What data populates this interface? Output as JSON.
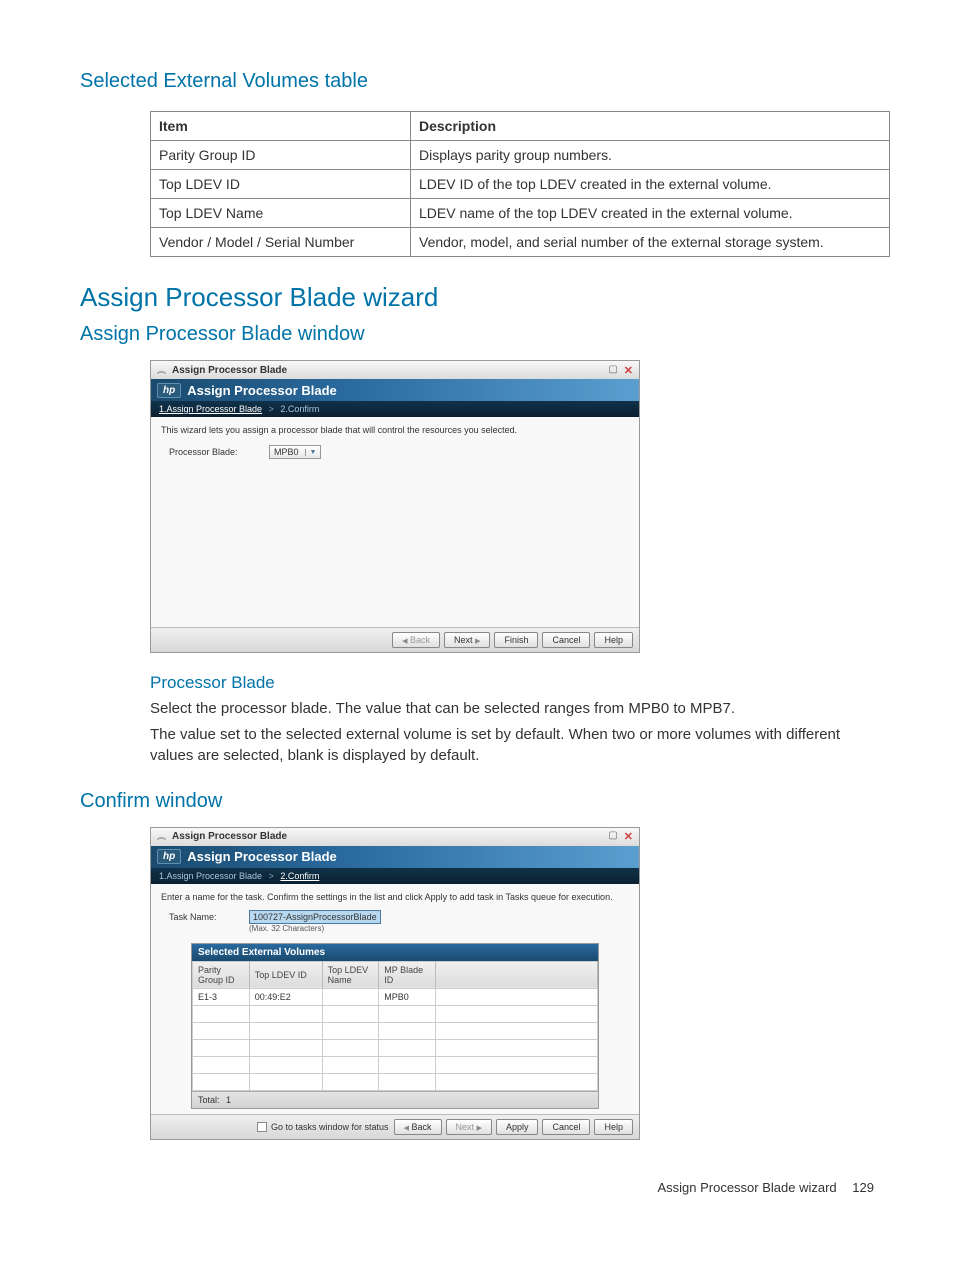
{
  "section1_title": "Selected External Volumes table",
  "table1": {
    "headers": [
      "Item",
      "Description"
    ],
    "rows": [
      [
        "Parity Group ID",
        "Displays parity group numbers."
      ],
      [
        "Top LDEV ID",
        "LDEV ID of the top LDEV created in the external volume."
      ],
      [
        "Top LDEV Name",
        "LDEV name of the top LDEV created in the external volume."
      ],
      [
        "Vendor / Model / Serial Number",
        "Vendor, model, and serial number of the external storage system."
      ]
    ]
  },
  "main_heading": "Assign Processor Blade wizard",
  "sub_heading1": "Assign Processor Blade window",
  "wizard1": {
    "titlebar": "Assign Processor Blade",
    "header": "Assign Processor Blade",
    "breadcrumb": {
      "step1": "1.Assign Processor Blade",
      "step2": "2.Confirm",
      "active": 1
    },
    "instruction": "This wizard lets you assign a processor blade that will control the resources you selected.",
    "field_label": "Processor Blade:",
    "dropdown_value": "MPB0",
    "buttons": {
      "back": "Back",
      "next": "Next",
      "finish": "Finish",
      "cancel": "Cancel",
      "help": "Help"
    }
  },
  "field_heading": "Processor Blade",
  "para1": "Select the processor blade. The value that can be selected ranges from MPB0 to MPB7.",
  "para2": "The value set to the selected external volume is set by default. When two or more volumes with different values are selected, blank is displayed by default.",
  "sub_heading2": "Confirm window",
  "wizard2": {
    "titlebar": "Assign Processor Blade",
    "header": "Assign Processor Blade",
    "breadcrumb": {
      "step1": "1.Assign Processor Blade",
      "step2": "2.Confirm",
      "active": 2
    },
    "instruction": "Enter a name for the task. Confirm the settings in the list and click Apply to add task in Tasks queue for execution.",
    "task_label": "Task Name:",
    "task_value": "100727-AssignProcessorBlade",
    "task_hint": "(Max. 32 Characters)",
    "sev_title": "Selected External Volumes",
    "sev_headers": [
      "Parity Group ID",
      "Top LDEV ID",
      "Top LDEV Name",
      "MP Blade ID"
    ],
    "sev_rows": [
      [
        "E1-3",
        "00:49:E2",
        "",
        "MPB0"
      ]
    ],
    "total_label": "Total:",
    "total_value": "1",
    "footer_checkbox_label": "Go to tasks window for status",
    "buttons": {
      "back": "Back",
      "next": "Next",
      "apply": "Apply",
      "cancel": "Cancel",
      "help": "Help"
    }
  },
  "footer": {
    "text": "Assign Processor Blade wizard",
    "page": "129"
  }
}
